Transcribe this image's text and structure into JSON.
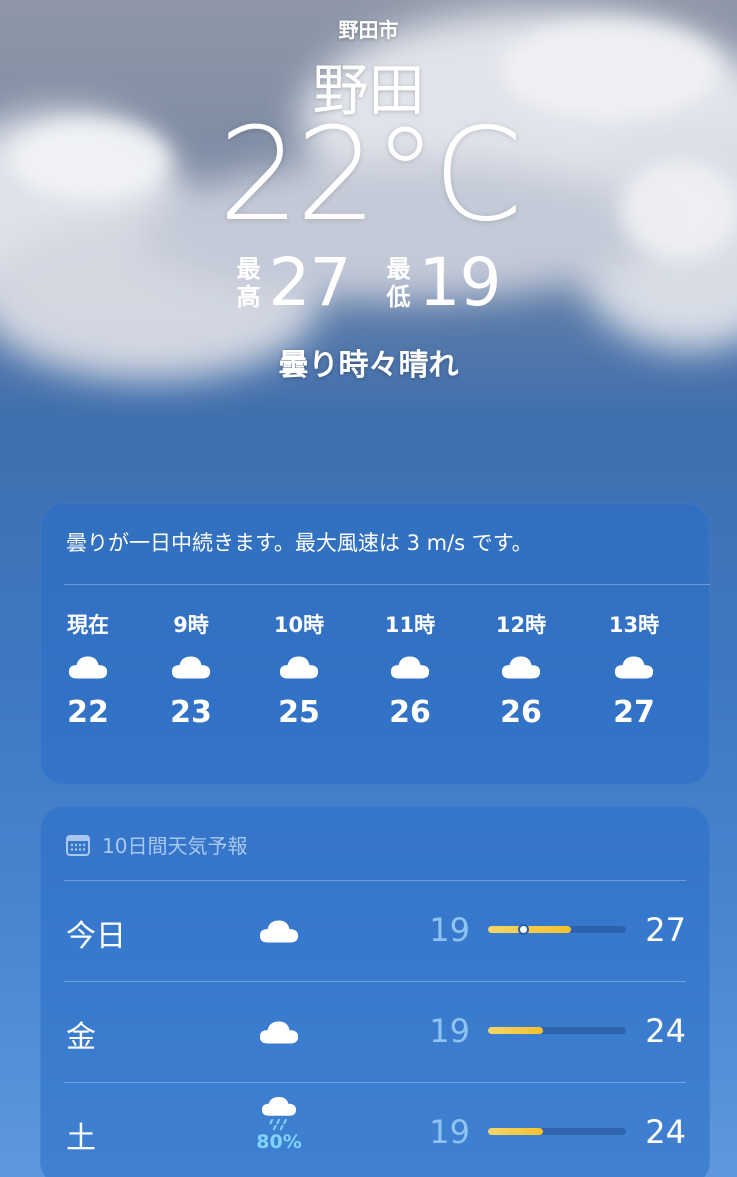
{
  "location": {
    "sub": "野田市",
    "name": "野田"
  },
  "current": {
    "temperature": "22°C",
    "high_label": "最高",
    "high": "27",
    "low_label": "最低",
    "low": "19",
    "condition": "曇り時々晴れ"
  },
  "hourly": {
    "summary": "曇りが一日中続きます。最大風速は 3 m/s です。",
    "items": [
      {
        "time": "現在",
        "icon": "cloud-icon",
        "temp": "22"
      },
      {
        "time": "9時",
        "icon": "cloud-icon",
        "temp": "23"
      },
      {
        "time": "10時",
        "icon": "cloud-icon",
        "temp": "25"
      },
      {
        "time": "11時",
        "icon": "cloud-icon",
        "temp": "26"
      },
      {
        "time": "12時",
        "icon": "cloud-icon",
        "temp": "26"
      },
      {
        "time": "13時",
        "icon": "cloud-icon",
        "temp": "27"
      }
    ]
  },
  "forecast": {
    "header": "10日間天気予報",
    "header_icon": "calendar-icon",
    "days": [
      {
        "day": "今日",
        "icon": "cloud-icon",
        "pop": "",
        "low": "19",
        "high": "27",
        "range_start": 0.0,
        "range_end": 0.6,
        "current_marker": 0.25
      },
      {
        "day": "金",
        "icon": "cloud-icon",
        "pop": "",
        "low": "19",
        "high": "24",
        "range_start": 0.0,
        "range_end": 0.4,
        "current_marker": null
      },
      {
        "day": "土",
        "icon": "cloud-rain-icon",
        "pop": "80%",
        "low": "19",
        "high": "24",
        "range_start": 0.0,
        "range_end": 0.4,
        "current_marker": null
      }
    ]
  },
  "colors": {
    "bar_fill": "#f6c12c",
    "low_temp": "#8fc4f2",
    "precip": "#7fd3ff"
  }
}
